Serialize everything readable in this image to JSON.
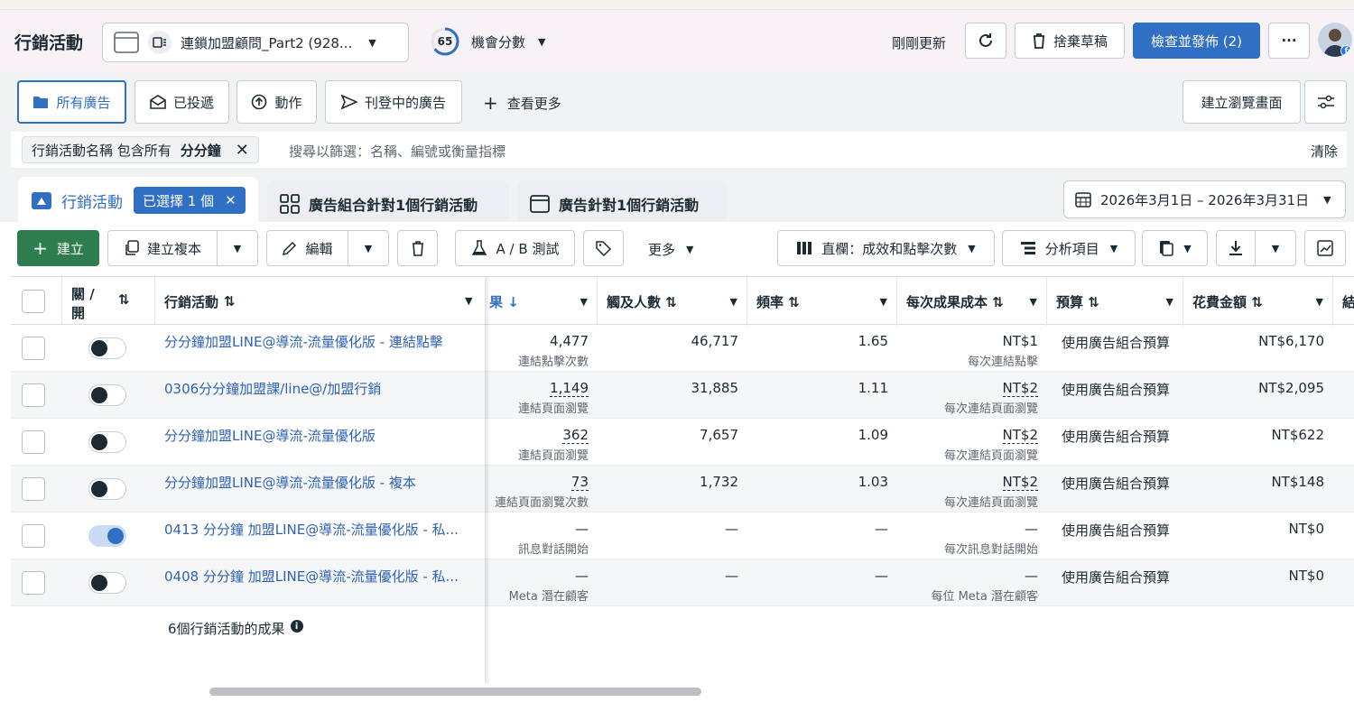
{
  "header": {
    "title": "行銷活動",
    "account": "連鎖加盟顧問_Part2 (928...",
    "score_value": "65",
    "score_label": "機會分數",
    "updated": "剛剛更新",
    "discard": "捨棄草稿",
    "publish": "檢查並發佈 (2)",
    "more": "···"
  },
  "nav": {
    "all_ads": "所有廣告",
    "delivered": "已投遞",
    "actions": "動作",
    "active_ads": "刊登中的廣告",
    "see_more": "查看更多",
    "create_view": "建立瀏覽畫面"
  },
  "filter": {
    "chip_prefix": "行銷活動名稱 包含所有",
    "chip_value": "分分鐘",
    "placeholder": "搜尋以篩選：名稱、編號或衡量指標",
    "clear": "清除"
  },
  "tabs": {
    "campaigns": "行銷活動",
    "selected": "已選擇 1 個",
    "adsets": "廣告組合針對1個行銷活動",
    "ads": "廣告針對1個行銷活動",
    "date_range": "2026年3月1日 – 2026年3月31日"
  },
  "toolbar": {
    "create": "建立",
    "duplicate": "建立複本",
    "edit": "編輯",
    "ab_test": "A / B 測試",
    "more": "更多",
    "columns": "直欄：成效和點擊次數",
    "breakdown": "分析項目"
  },
  "columns": {
    "onoff_1": "關 /",
    "onoff_2": "開",
    "campaign": "行銷活動",
    "results": "果",
    "reach": "觸及人數",
    "frequency": "頻率",
    "cost_per_result": "每次成果成本",
    "budget": "預算",
    "spend": "花費金額",
    "end_partial": "結"
  },
  "rows": [
    {
      "name": "分分鐘加盟LINE@導流-流量優化版 - 連結點擊",
      "on": false,
      "results": "4,477",
      "results_sub": "連結點擊次數",
      "reach": "46,717",
      "freq": "1.65",
      "cpr": "NT$1",
      "cpr_sub": "每次連結點擊",
      "budget": "使用廣告組合預算",
      "spend": "NT$6,170"
    },
    {
      "name": "0306分分鐘加盟課/line@/加盟行銷",
      "on": false,
      "results": "1,149",
      "results_sub": "連結頁面瀏覽",
      "reach": "31,885",
      "freq": "1.11",
      "cpr": "NT$2",
      "cpr_sub": "每次連結頁面瀏覽",
      "budget": "使用廣告組合預算",
      "spend": "NT$2,095"
    },
    {
      "name": "分分鐘加盟LINE@導流-流量優化版",
      "on": false,
      "results": "362",
      "results_sub": "連結頁面瀏覽",
      "reach": "7,657",
      "freq": "1.09",
      "cpr": "NT$2",
      "cpr_sub": "每次連結頁面瀏覽",
      "budget": "使用廣告組合預算",
      "spend": "NT$622"
    },
    {
      "name": "分分鐘加盟LINE@導流-流量優化版 - 複本",
      "on": false,
      "results": "73",
      "results_sub": "連結頁面瀏覽次數",
      "reach": "1,732",
      "freq": "1.03",
      "cpr": "NT$2",
      "cpr_sub": "每次連結頁面瀏覽",
      "budget": "使用廣告組合預算",
      "spend": "NT$148"
    },
    {
      "name": "0413 分分鐘 加盟LINE@導流-流量優化版 - 私...",
      "on": true,
      "results": "—",
      "results_sub": "訊息對話開始",
      "reach": "—",
      "freq": "—",
      "cpr": "—",
      "cpr_sub": "每次訊息對話開始",
      "budget": "使用廣告組合預算",
      "spend": "NT$0"
    },
    {
      "name": "0408 分分鐘 加盟LINE@導流-流量優化版 - 私...",
      "on": false,
      "results": "—",
      "results_sub": "Meta 潛在顧客",
      "reach": "—",
      "freq": "—",
      "cpr": "—",
      "cpr_sub": "每位 Meta 潛在顧客",
      "budget": "使用廣告組合預算",
      "spend": "NT$0"
    }
  ],
  "footer": {
    "summary": "6個行銷活動的成果"
  }
}
